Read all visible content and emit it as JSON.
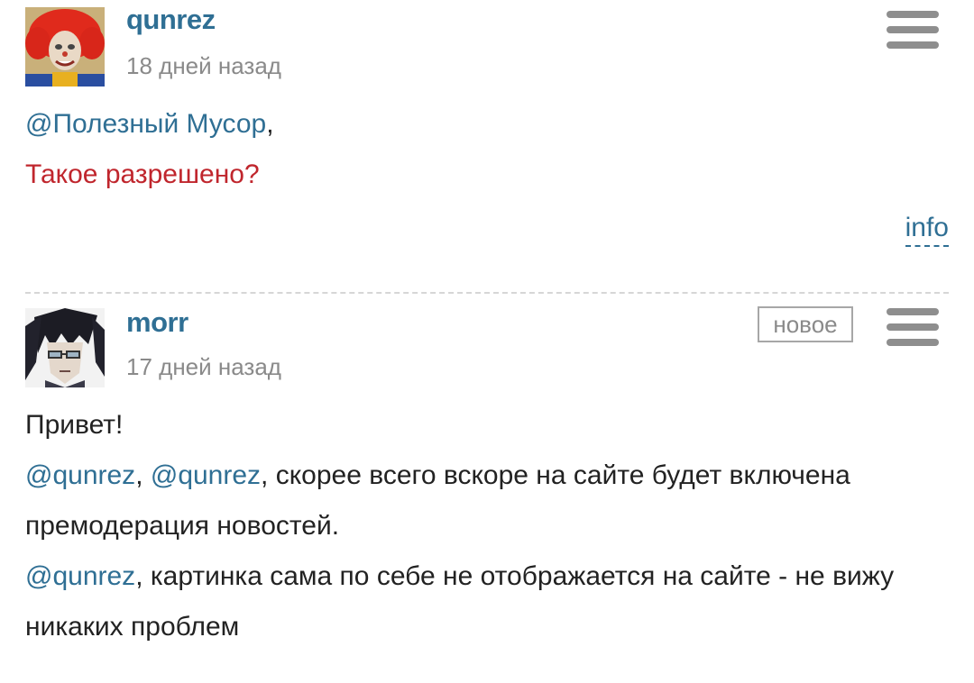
{
  "comments": [
    {
      "username": "qunrez",
      "time": "18 дней назад",
      "mention": "@Полезный Мусор",
      "mention_suffix": ",",
      "question": "Такое разрешено?",
      "info_label": "info"
    },
    {
      "username": "morr",
      "time": "17 дней назад",
      "badge": "новое",
      "greeting": "Привет!",
      "para2": {
        "mention1": "@qunrez",
        "sep": ", ",
        "mention2": "@qunrez",
        "text": ", скорее всего вскоре на сайте будет включена премодерация новостей."
      },
      "para3": {
        "mention": "@qunrez",
        "text": ", картинка сама по себе не отображается на сайте - не вижу никаких проблем"
      }
    }
  ],
  "colors": {
    "link": "#2f6f94",
    "red": "#c0262d",
    "muted": "#8a8a8a"
  },
  "icons": {
    "menu": "hamburger-icon"
  }
}
